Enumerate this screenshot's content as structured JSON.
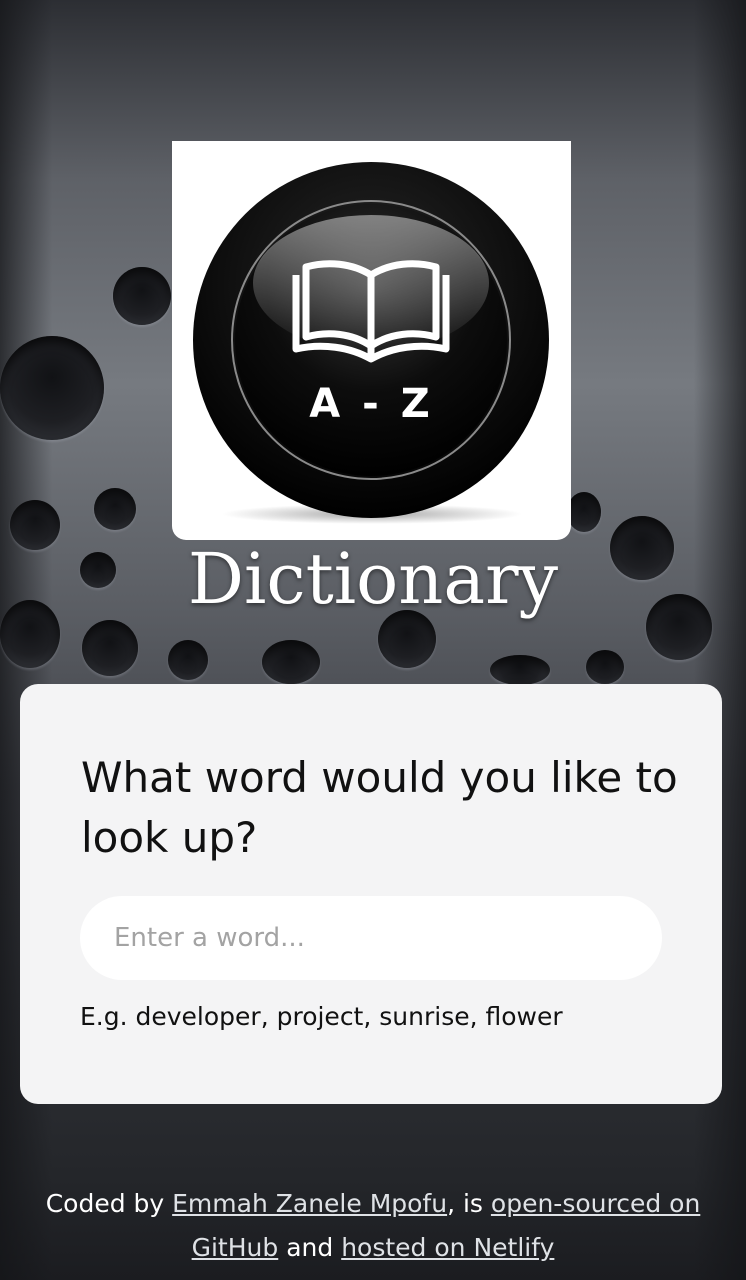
{
  "app": {
    "logo_text": "A - Z",
    "title": "Dictionary"
  },
  "search": {
    "heading": "What word would you like to look up?",
    "placeholder": "Enter a word...",
    "value": "",
    "examples": "E.g. developer, project, sunrise, flower"
  },
  "footer": {
    "coded_by": "Coded by ",
    "author_link": "Emmah Zanele Mpofu",
    "sep1": ", is ",
    "github_link": "open-sourced on GitHub",
    "sep2": " and ",
    "netlify_link": "hosted on Netlify"
  },
  "icons": {
    "logo": "book-icon"
  },
  "colors": {
    "card_background": "#f4f4f5",
    "title_color": "#ffffff",
    "text_dark": "#111111"
  }
}
